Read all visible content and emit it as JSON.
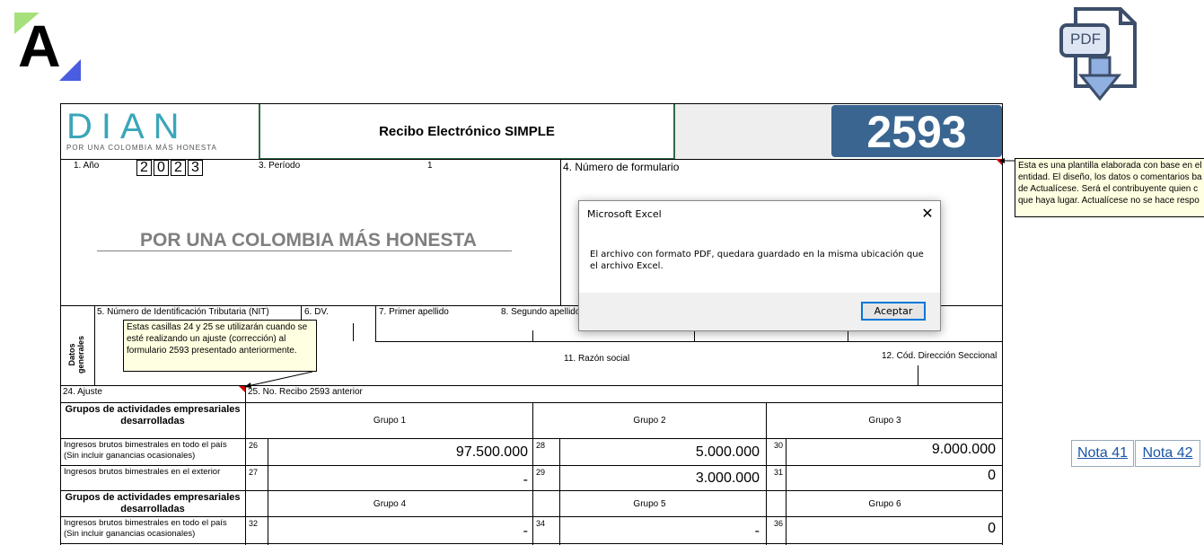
{
  "logo": {
    "letter": "A"
  },
  "pdf_icon": {
    "label": "PDF"
  },
  "form": {
    "brand": {
      "name": "DIAN",
      "tagline": "POR UNA COLOMBIA MÁS HONESTA"
    },
    "title": "Recibo Electrónico SIMPLE",
    "form_number": "2593",
    "year_label": "1. Año",
    "year_digits": [
      "2",
      "0",
      "2",
      "3"
    ],
    "period_label": "3. Período",
    "period_value": "1",
    "formulario_label": "4. Número de formulario",
    "slogan": "POR UNA COLOMBIA MÁS HONESTA",
    "datos_generales": "Datos generales",
    "nit_label": "5. Número de Identificación Tributaria (NIT)",
    "dv_label": "6. DV.",
    "primer_apellido_label": "7. Primer apellido",
    "segundo_apellido_label": "8. Segundo apellido",
    "razon_social_label": "11. Razón social",
    "cod_direccion_label": "12. Cód. Dirección Seccional",
    "ajuste_label": "24. Ajuste",
    "recibo_anterior_label": "25. No. Recibo 2593 anterior",
    "grupos_header": "Grupos de actividades empresariales desarrolladas",
    "grupo1": "Grupo 1",
    "grupo2": "Grupo 2",
    "grupo3": "Grupo 3",
    "grupo4": "Grupo 4",
    "grupo5": "Grupo 5",
    "grupo6": "Grupo 6",
    "ingresos_pais_label": "Ingresos brutos bimestrales en todo el país (Sin incluir ganancias ocasionales)",
    "ingresos_exterior_label": "Ingresos brutos bimestrales en el exterior",
    "cells": {
      "c26": {
        "idx": "26",
        "value": "97.500.000"
      },
      "c28": {
        "idx": "28",
        "value": "5.000.000"
      },
      "c30": {
        "idx": "30",
        "value": "9.000.000"
      },
      "c27": {
        "idx": "27",
        "value": "-"
      },
      "c29": {
        "idx": "29",
        "value": "3.000.000"
      },
      "c31": {
        "idx": "31",
        "value": "0"
      },
      "c32": {
        "idx": "32",
        "value": "-"
      },
      "c34": {
        "idx": "34",
        "value": "-"
      },
      "c36": {
        "idx": "36",
        "value": "0"
      }
    }
  },
  "comment_right": {
    "lines": [
      "Esta es una plantilla elaborada con base en el",
      "entidad. El diseño, los datos o comentarios ba",
      "de Actualícese. Será el contribuyente quien c",
      "que haya lugar. Actualícese no se hace respo"
    ]
  },
  "comment_left": {
    "text": "Estas casillas 24 y 25 se utilizarán cuando se esté realizando un ajuste (corrección) al formulario 2593 presentado anteriormente."
  },
  "dialog": {
    "title": "Microsoft Excel",
    "message": "El archivo con formato PDF, quedara guardado en la misma ubicación que el archivo Excel.",
    "button": "Aceptar"
  },
  "notes": {
    "nota41": "Nota 41",
    "nota42": "Nota 42"
  },
  "colors": {
    "dian_teal": "#3aa6b9",
    "form_number_bg": "#3a6591",
    "dialog_button_border": "#0078d7",
    "link": "#1a55a7"
  }
}
